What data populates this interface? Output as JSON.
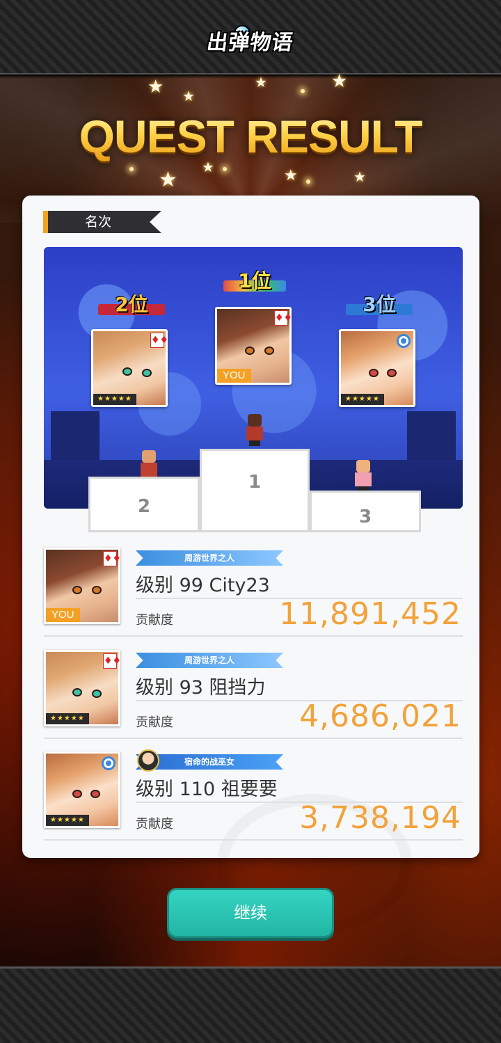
{
  "header": {
    "logo_text": "出弹物语",
    "title": "QUEST RESULT"
  },
  "section": {
    "label": "名次"
  },
  "podium": {
    "first": {
      "rank_label": "1位",
      "block_number": "1",
      "you_tag": "YOU"
    },
    "second": {
      "rank_label": "2位",
      "block_number": "2",
      "stars": "★★★★★"
    },
    "third": {
      "rank_label": "3位",
      "block_number": "3",
      "stars": "★★★★★"
    }
  },
  "results": [
    {
      "title_badge": "周游世界之人",
      "name": "级别 99 City23",
      "contribution_label": "贡献度",
      "score": "11,891,452",
      "you_tag": "YOU"
    },
    {
      "title_badge": "周游世界之人",
      "name": "级别 93 阻挡力",
      "contribution_label": "贡献度",
      "score": "4,686,021",
      "stars": "★★★★★"
    },
    {
      "title_badge": "宿命的战巫女",
      "name": "级别 110 祖要要",
      "contribution_label": "贡献度",
      "score": "3,738,194",
      "stars": "★★★★★"
    }
  ],
  "footer": {
    "continue_label": "继续"
  },
  "colors": {
    "accent_orange": "#f2a23a",
    "button_teal": "#2bc4b2",
    "title_gold": "#ffd34a"
  }
}
